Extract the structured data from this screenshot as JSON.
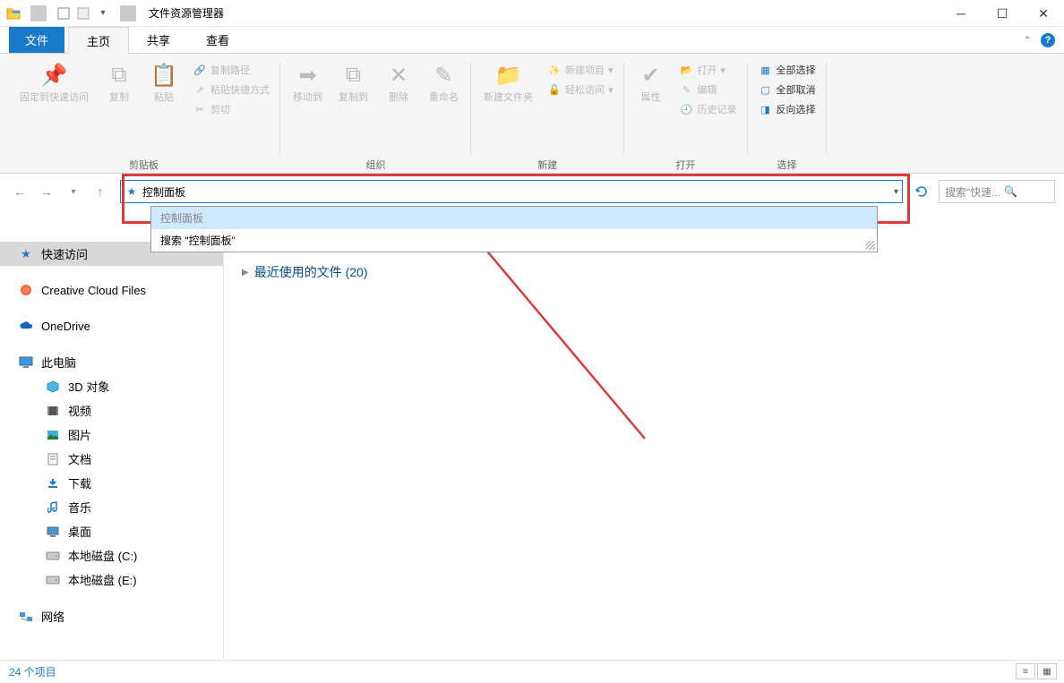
{
  "window": {
    "title": "文件资源管理器",
    "qat_dropdown": "▾"
  },
  "tabs": {
    "file": "文件",
    "home": "主页",
    "share": "共享",
    "view": "查看"
  },
  "ribbon": {
    "clipboard": {
      "pin": "固定到快速访问",
      "copy": "复制",
      "paste": "粘贴",
      "copy_path": "复制路径",
      "paste_shortcut": "粘贴快捷方式",
      "cut": "剪切",
      "label": "剪贴板"
    },
    "organize": {
      "move_to": "移动到",
      "copy_to": "复制到",
      "delete": "删除",
      "rename": "重命名",
      "label": "组织"
    },
    "new": {
      "new_folder": "新建文件夹",
      "new_item": "新建项目",
      "easy_access": "轻松访问",
      "label": "新建"
    },
    "open": {
      "properties": "属性",
      "open": "打开",
      "edit": "编辑",
      "history": "历史记录",
      "label": "打开"
    },
    "select": {
      "select_all": "全部选择",
      "select_none": "全部取消",
      "invert": "反向选择",
      "label": "选择"
    }
  },
  "nav": {
    "address_text": "控制面板",
    "dropdown_item1": "控制面板",
    "dropdown_item2": "搜索 \"控制面板\"",
    "search_placeholder": "搜索\"快速..."
  },
  "sidebar": {
    "quick_access": "快速访问",
    "creative_cloud": "Creative Cloud Files",
    "onedrive": "OneDrive",
    "this_pc": "此电脑",
    "objects_3d": "3D 对象",
    "videos": "视频",
    "pictures": "图片",
    "documents": "文档",
    "downloads": "下载",
    "music": "音乐",
    "desktop": "桌面",
    "drive_c": "本地磁盘 (C:)",
    "drive_e": "本地磁盘 (E:)",
    "network": "网络"
  },
  "content": {
    "recent_files": "最近使用的文件 (20)"
  },
  "status": {
    "items": "24 个项目"
  }
}
